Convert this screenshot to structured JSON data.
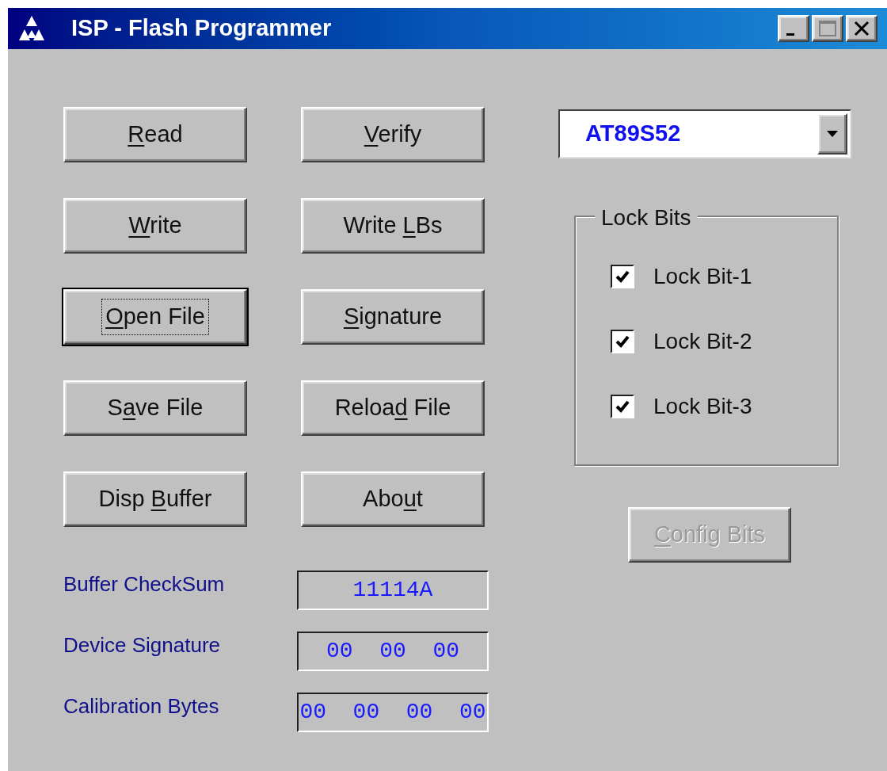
{
  "window": {
    "title": "ISP - Flash Programmer"
  },
  "buttons": [
    {
      "key": "R",
      "after": "ead",
      "default": false
    },
    {
      "key": "V",
      "after": "erify",
      "default": false
    },
    {
      "key": "W",
      "after": "rite",
      "default": false
    },
    {
      "before": "Write ",
      "key": "L",
      "after": "Bs",
      "default": false
    },
    {
      "key": "O",
      "after": "pen File",
      "default": true
    },
    {
      "key": "S",
      "after": "ignature",
      "default": false
    },
    {
      "before": "S",
      "key": "a",
      "after": "ve File",
      "default": false
    },
    {
      "before": "Reloa",
      "key": "d",
      "after": " File",
      "default": false
    },
    {
      "before": "Disp ",
      "key": "B",
      "after": "uffer",
      "default": false
    },
    {
      "before": "Abo",
      "key": "u",
      "after": "t",
      "default": false
    }
  ],
  "readouts": [
    {
      "label": "Buffer CheckSum",
      "value": "11114A"
    },
    {
      "label": "Device Signature",
      "value": "00  00  00"
    },
    {
      "label": "Calibration Bytes",
      "value": "00  00  00  00"
    }
  ],
  "device_select": {
    "value": "AT89S52"
  },
  "lock_bits": {
    "title": "Lock Bits",
    "items": [
      {
        "label": "Lock Bit-1",
        "checked": true
      },
      {
        "label": "Lock Bit-2",
        "checked": true
      },
      {
        "label": "Lock Bit-3",
        "checked": true
      }
    ]
  },
  "config_button": {
    "key": "C",
    "after": "onfig Bits",
    "disabled": true
  }
}
